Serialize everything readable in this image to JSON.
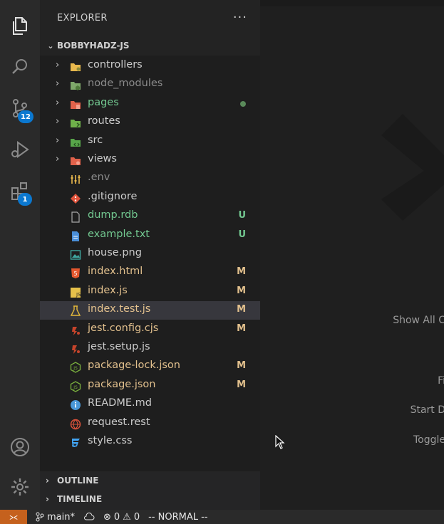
{
  "activity_bar": {
    "items": [
      {
        "name": "explorer",
        "icon": "files-icon"
      },
      {
        "name": "search",
        "icon": "search-icon"
      },
      {
        "name": "source-control",
        "icon": "source-control-icon",
        "badge": "12"
      },
      {
        "name": "run-debug",
        "icon": "debug-icon"
      },
      {
        "name": "extensions",
        "icon": "extensions-icon",
        "badge": "1"
      }
    ],
    "bottom": [
      {
        "name": "accounts",
        "icon": "account-icon"
      },
      {
        "name": "manage",
        "icon": "gear-icon"
      }
    ]
  },
  "explorer": {
    "title": "EXPLORER",
    "more": "···",
    "folder": "BOBBYHADZ-JS",
    "items": [
      {
        "label": "controllers",
        "type": "folder",
        "color": "#cccccc",
        "status": ""
      },
      {
        "label": "node_modules",
        "type": "folder",
        "color": "#8c8c8c",
        "status": ""
      },
      {
        "label": "pages",
        "type": "folder",
        "color": "#73c991",
        "status": "dot"
      },
      {
        "label": "routes",
        "type": "folder",
        "color": "#cccccc",
        "status": ""
      },
      {
        "label": "src",
        "type": "folder",
        "color": "#cccccc",
        "status": ""
      },
      {
        "label": "views",
        "type": "folder",
        "color": "#cccccc",
        "status": ""
      },
      {
        "label": ".env",
        "type": "file",
        "color": "#8c8c8c",
        "status": ""
      },
      {
        "label": ".gitignore",
        "type": "file",
        "color": "#cccccc",
        "status": ""
      },
      {
        "label": "dump.rdb",
        "type": "file",
        "color": "#73c991",
        "status": "U"
      },
      {
        "label": "example.txt",
        "type": "file",
        "color": "#73c991",
        "status": "U"
      },
      {
        "label": "house.png",
        "type": "file",
        "color": "#cccccc",
        "status": ""
      },
      {
        "label": "index.html",
        "type": "file",
        "color": "#e2c08d",
        "status": "M"
      },
      {
        "label": "index.js",
        "type": "file",
        "color": "#e2c08d",
        "status": "M"
      },
      {
        "label": "index.test.js",
        "type": "file",
        "color": "#e2c08d",
        "status": "M",
        "selected": true
      },
      {
        "label": "jest.config.cjs",
        "type": "file",
        "color": "#e2c08d",
        "status": "M"
      },
      {
        "label": "jest.setup.js",
        "type": "file",
        "color": "#cccccc",
        "status": ""
      },
      {
        "label": "package-lock.json",
        "type": "file",
        "color": "#e2c08d",
        "status": "M"
      },
      {
        "label": "package.json",
        "type": "file",
        "color": "#e2c08d",
        "status": "M"
      },
      {
        "label": "README.md",
        "type": "file",
        "color": "#cccccc",
        "status": ""
      },
      {
        "label": "request.rest",
        "type": "file",
        "color": "#cccccc",
        "status": ""
      },
      {
        "label": "style.css",
        "type": "file",
        "color": "#cccccc",
        "status": ""
      }
    ],
    "outline": "OUTLINE",
    "timeline": "TIMELINE"
  },
  "editor": {
    "hints": [
      "Show All C",
      "Fi",
      "Start D",
      "Toggle"
    ]
  },
  "status_bar": {
    "branch": "main*",
    "errors": "0",
    "warnings": "0",
    "mode": "-- NORMAL --"
  },
  "colors": {
    "untracked": "#73c991",
    "modified": "#e2c08d",
    "accent": "#0b78d0",
    "remote": "#c5611d"
  }
}
